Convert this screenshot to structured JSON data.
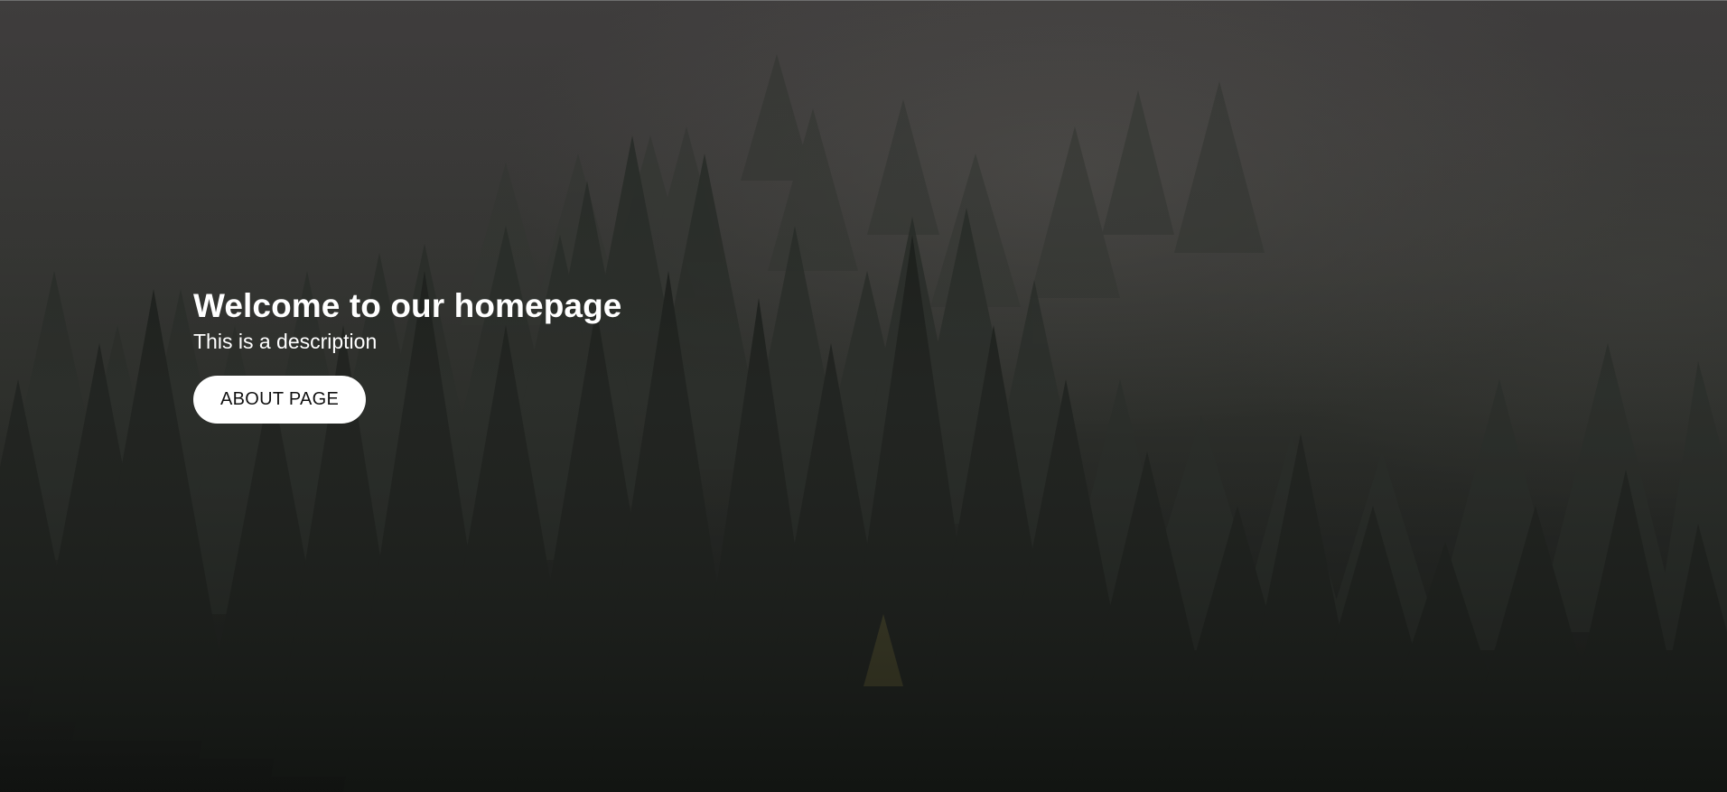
{
  "hero": {
    "title": "Welcome to our homepage",
    "description": "This is a description",
    "button_label": "ABOUT PAGE",
    "background_image": "foggy-pine-forest"
  },
  "colors": {
    "text": "#ffffff",
    "button_bg": "#ffffff",
    "button_text": "#111111",
    "fog": "#3f3d3d",
    "forest_dark": "#131513"
  }
}
